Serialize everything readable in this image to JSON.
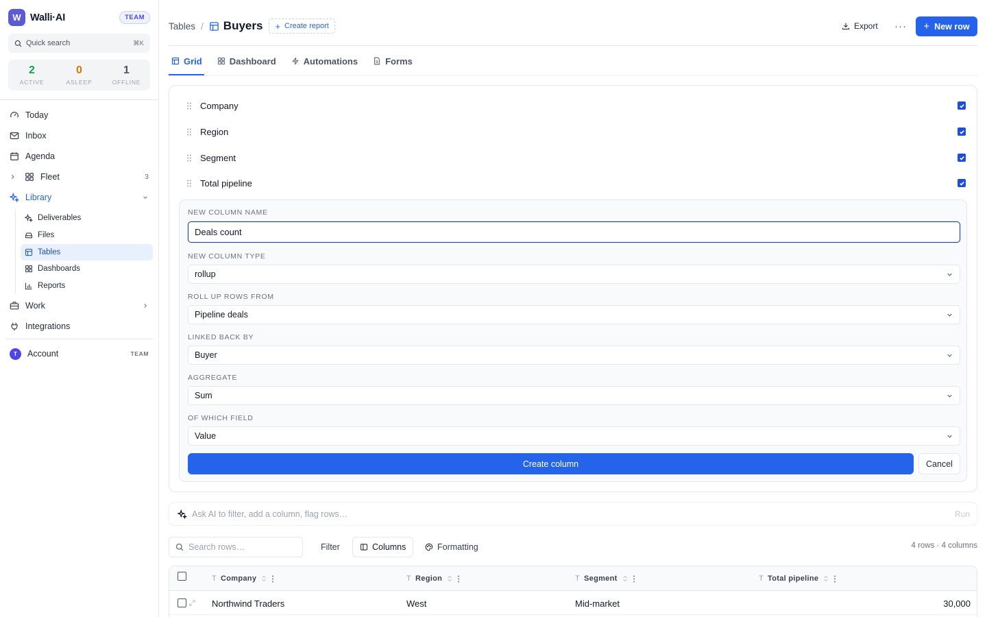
{
  "app": {
    "name": "Walli·AI",
    "badge": "TEAM",
    "logo_letter": "W"
  },
  "search": {
    "label": "Quick search",
    "shortcut": "⌘K"
  },
  "stats": [
    {
      "value": "2",
      "label": "ACTIVE",
      "color": "#16a34a"
    },
    {
      "value": "0",
      "label": "ASLEEP",
      "color": "#d97706"
    },
    {
      "value": "1",
      "label": "OFFLINE",
      "color": "#4b5563"
    }
  ],
  "nav": {
    "today": "Today",
    "inbox": "Inbox",
    "agenda": "Agenda",
    "fleet": {
      "label": "Fleet",
      "count": "3"
    },
    "library": "Library",
    "library_items": [
      "Deliverables",
      "Files",
      "Tables",
      "Dashboards",
      "Reports"
    ],
    "work": "Work",
    "integrations": "Integrations"
  },
  "account": {
    "label": "Account",
    "badge": "TEAM",
    "avatar_letter": "T"
  },
  "header": {
    "breadcrumb_parent": "Tables",
    "separator": "/",
    "title": "Buyers",
    "create_report": "Create report",
    "export": "Export",
    "more": "···",
    "new_row": "New row"
  },
  "tabs": [
    "Grid",
    "Dashboard",
    "Automations",
    "Forms"
  ],
  "columns_panel": {
    "columns": [
      {
        "name": "Company",
        "visible": true
      },
      {
        "name": "Region",
        "visible": true
      },
      {
        "name": "Segment",
        "visible": true
      },
      {
        "name": "Total pipeline",
        "visible": true
      }
    ],
    "form": {
      "name_label": "NEW COLUMN NAME",
      "name_value": "Deals count",
      "type_label": "NEW COLUMN TYPE",
      "type_value": "rollup",
      "rollup_label": "ROLL UP ROWS FROM",
      "rollup_value": "Pipeline deals",
      "linked_label": "LINKED BACK BY",
      "linked_value": "Buyer",
      "aggregate_label": "AGGREGATE",
      "aggregate_value": "Sum",
      "field_label": "OF WHICH FIELD",
      "field_value": "Value",
      "create": "Create column",
      "cancel": "Cancel"
    }
  },
  "ai": {
    "placeholder": "Ask AI to filter, add a column, flag rows…",
    "run": "Run"
  },
  "toolbar": {
    "search_placeholder": "Search rows…",
    "filter": "Filter",
    "columns": "Columns",
    "formatting": "Formatting",
    "count": "4 rows · 4 columns"
  },
  "table": {
    "headers": [
      "Company",
      "Region",
      "Segment",
      "Total pipeline"
    ],
    "rows": [
      [
        "Northwind Traders",
        "West",
        "Mid-market",
        "30,000"
      ]
    ]
  },
  "colors": {
    "accent": "#2563eb",
    "brand": "#5b5bd6"
  }
}
